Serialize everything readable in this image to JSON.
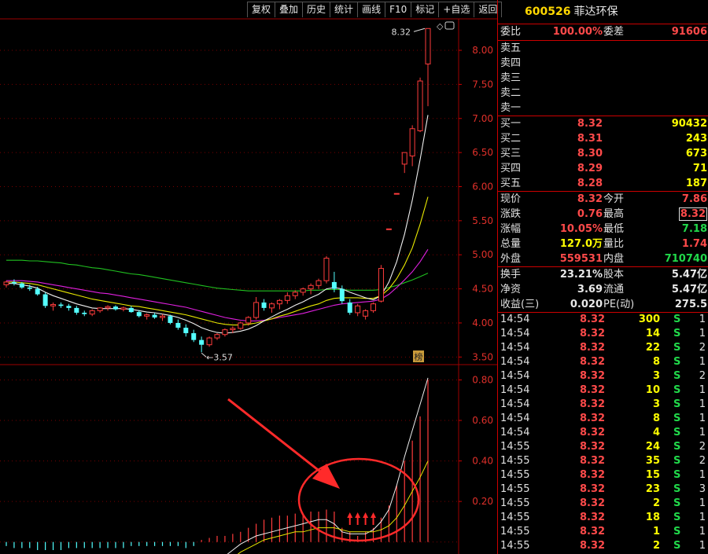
{
  "toolbar": [
    "复权",
    "叠加",
    "历史",
    "统计",
    "画线",
    "F10",
    "标记",
    "+自选",
    "返回"
  ],
  "stock": {
    "code": "600526",
    "name": "菲达环保"
  },
  "weibi": {
    "label": "委比",
    "value": "100.00%",
    "label2": "委差",
    "value2": "91606"
  },
  "sells": [
    {
      "label": "卖五"
    },
    {
      "label": "卖四"
    },
    {
      "label": "卖三"
    },
    {
      "label": "卖二"
    },
    {
      "label": "卖一"
    }
  ],
  "buys": [
    {
      "label": "买一",
      "price": "8.32",
      "volume": "90432"
    },
    {
      "label": "买二",
      "price": "8.31",
      "volume": "243"
    },
    {
      "label": "买三",
      "price": "8.30",
      "volume": "673"
    },
    {
      "label": "买四",
      "price": "8.29",
      "volume": "71"
    },
    {
      "label": "买五",
      "price": "8.28",
      "volume": "187"
    }
  ],
  "quote": [
    {
      "l1": "现价",
      "v1": "8.32",
      "c1": "red",
      "l2": "今开",
      "v2": "7.86",
      "c2": "red"
    },
    {
      "l1": "涨跌",
      "v1": "0.76",
      "c1": "red",
      "l2": "最高",
      "v2": "8.32",
      "c2": "red",
      "boxed": true
    },
    {
      "l1": "涨幅",
      "v1": "10.05%",
      "c1": "red",
      "l2": "最低",
      "v2": "7.18",
      "c2": "grn"
    },
    {
      "l1": "总量",
      "v1": "127.0万",
      "c1": "yel",
      "l2": "量比",
      "v2": "1.74",
      "c2": "red"
    },
    {
      "l1": "外盘",
      "v1": "559531",
      "c1": "red",
      "l2": "内盘",
      "v2": "710740",
      "c2": "grn"
    }
  ],
  "fundamentals": [
    {
      "l1": "换手",
      "v1": "23.21%",
      "l2": "股本",
      "v2": "5.47亿"
    },
    {
      "l1": "净资",
      "v1": "3.69",
      "l2": "流通",
      "v2": "5.47亿"
    },
    {
      "l1": "收益(三)",
      "v1": "0.020",
      "l2": "PE(动)",
      "v2": "275.5"
    }
  ],
  "ticks": [
    {
      "time": "14:54",
      "price": "8.32",
      "vol": "300",
      "side": "S",
      "n": "1"
    },
    {
      "time": "14:54",
      "price": "8.32",
      "vol": "14",
      "side": "S",
      "n": "1"
    },
    {
      "time": "14:54",
      "price": "8.32",
      "vol": "22",
      "side": "S",
      "n": "2"
    },
    {
      "time": "14:54",
      "price": "8.32",
      "vol": "8",
      "side": "S",
      "n": "1"
    },
    {
      "time": "14:54",
      "price": "8.32",
      "vol": "3",
      "side": "S",
      "n": "2"
    },
    {
      "time": "14:54",
      "price": "8.32",
      "vol": "10",
      "side": "S",
      "n": "1"
    },
    {
      "time": "14:54",
      "price": "8.32",
      "vol": "3",
      "side": "S",
      "n": "1"
    },
    {
      "time": "14:54",
      "price": "8.32",
      "vol": "8",
      "side": "S",
      "n": "1"
    },
    {
      "time": "14:54",
      "price": "8.32",
      "vol": "4",
      "side": "S",
      "n": "1"
    },
    {
      "time": "14:55",
      "price": "8.32",
      "vol": "24",
      "side": "S",
      "n": "2"
    },
    {
      "time": "14:55",
      "price": "8.32",
      "vol": "35",
      "side": "S",
      "n": "2"
    },
    {
      "time": "14:55",
      "price": "8.32",
      "vol": "15",
      "side": "S",
      "n": "1"
    },
    {
      "time": "14:55",
      "price": "8.32",
      "vol": "23",
      "side": "S",
      "n": "3"
    },
    {
      "time": "14:55",
      "price": "8.32",
      "vol": "2",
      "side": "S",
      "n": "1"
    },
    {
      "time": "14:55",
      "price": "8.32",
      "vol": "18",
      "side": "S",
      "n": "1"
    },
    {
      "time": "14:55",
      "price": "8.32",
      "vol": "1",
      "side": "S",
      "n": "1"
    },
    {
      "time": "14:55",
      "price": "8.32",
      "vol": "2",
      "side": "S",
      "n": "1"
    }
  ],
  "chart_data": {
    "type": "candlestick",
    "price_axis": {
      "ticks": [
        "8.00",
        "7.50",
        "7.00",
        "6.50",
        "6.00",
        "5.50",
        "5.00",
        "4.50",
        "4.00",
        "3.50"
      ],
      "range": [
        3.4,
        8.45
      ]
    },
    "indicator_axis": {
      "ticks": [
        "0.80",
        "0.60",
        "0.40",
        "0.20"
      ],
      "range": [
        -0.04,
        0.86
      ]
    },
    "high_label": "8.32",
    "low_label": "3.57",
    "badge": "榜",
    "candles": [
      [
        4.56,
        4.62,
        4.52,
        4.6
      ],
      [
        4.6,
        4.64,
        4.55,
        4.58
      ],
      [
        4.58,
        4.6,
        4.5,
        4.52
      ],
      [
        4.52,
        4.56,
        4.47,
        4.5
      ],
      [
        4.5,
        4.53,
        4.4,
        4.42
      ],
      [
        4.42,
        4.45,
        4.22,
        4.25
      ],
      [
        4.25,
        4.3,
        4.18,
        4.27
      ],
      [
        4.27,
        4.3,
        4.22,
        4.25
      ],
      [
        4.25,
        4.28,
        4.18,
        4.22
      ],
      [
        4.22,
        4.25,
        4.12,
        4.15
      ],
      [
        4.15,
        4.18,
        4.1,
        4.13
      ],
      [
        4.13,
        4.2,
        4.1,
        4.18
      ],
      [
        4.18,
        4.23,
        4.15,
        4.22
      ],
      [
        4.22,
        4.26,
        4.18,
        4.24
      ],
      [
        4.24,
        4.26,
        4.18,
        4.2
      ],
      [
        4.2,
        4.24,
        4.17,
        4.22
      ],
      [
        4.22,
        4.25,
        4.15,
        4.16
      ],
      [
        4.16,
        4.19,
        4.08,
        4.1
      ],
      [
        4.1,
        4.14,
        4.05,
        4.12
      ],
      [
        4.12,
        4.15,
        4.06,
        4.08
      ],
      [
        4.08,
        4.13,
        4.03,
        4.1
      ],
      [
        4.1,
        4.12,
        3.98,
        4.0
      ],
      [
        4.0,
        4.05,
        3.9,
        3.93
      ],
      [
        3.93,
        3.98,
        3.8,
        3.85
      ],
      [
        3.85,
        3.9,
        3.72,
        3.75
      ],
      [
        3.75,
        3.8,
        3.57,
        3.68
      ],
      [
        3.68,
        3.8,
        3.65,
        3.78
      ],
      [
        3.78,
        3.85,
        3.75,
        3.83
      ],
      [
        3.83,
        3.92,
        3.8,
        3.9
      ],
      [
        3.9,
        3.95,
        3.85,
        3.92
      ],
      [
        3.92,
        4.02,
        3.9,
        4.0
      ],
      [
        4.0,
        4.1,
        3.96,
        4.08
      ],
      [
        4.08,
        4.38,
        4.05,
        4.3
      ],
      [
        4.3,
        4.35,
        4.18,
        4.22
      ],
      [
        4.22,
        4.3,
        4.15,
        4.28
      ],
      [
        4.28,
        4.35,
        4.2,
        4.33
      ],
      [
        4.33,
        4.45,
        4.28,
        4.4
      ],
      [
        4.4,
        4.48,
        4.35,
        4.45
      ],
      [
        4.45,
        4.52,
        4.4,
        4.5
      ],
      [
        4.5,
        4.58,
        4.42,
        4.55
      ],
      [
        4.55,
        4.65,
        4.5,
        4.62
      ],
      [
        4.62,
        4.98,
        4.58,
        4.95
      ],
      [
        4.6,
        4.75,
        4.45,
        4.5
      ],
      [
        4.5,
        4.55,
        4.28,
        4.32
      ],
      [
        4.3,
        4.35,
        4.12,
        4.15
      ],
      [
        4.15,
        4.28,
        4.1,
        4.25
      ],
      [
        4.1,
        4.2,
        4.05,
        4.18
      ],
      [
        4.18,
        4.3,
        4.15,
        4.28
      ],
      [
        4.32,
        4.85,
        4.3,
        4.8
      ],
      [
        5.38,
        5.38,
        5.38,
        5.38
      ],
      [
        5.9,
        5.9,
        5.9,
        5.9
      ],
      [
        6.33,
        6.5,
        6.2,
        6.5
      ],
      [
        6.45,
        6.9,
        6.3,
        6.85
      ],
      [
        6.82,
        7.6,
        6.8,
        7.55
      ],
      [
        7.8,
        8.32,
        7.18,
        8.32
      ]
    ],
    "ma_lines": {
      "white": [
        4.58,
        4.58,
        4.56,
        4.54,
        4.51,
        4.45,
        4.4,
        4.36,
        4.32,
        4.28,
        4.25,
        4.22,
        4.21,
        4.21,
        4.21,
        4.21,
        4.2,
        4.18,
        4.16,
        4.15,
        4.13,
        4.11,
        4.08,
        4.04,
        3.99,
        3.93,
        3.89,
        3.86,
        3.85,
        3.86,
        3.88,
        3.91,
        3.96,
        4.03,
        4.09,
        4.15,
        4.2,
        4.26,
        4.31,
        4.37,
        4.42,
        4.5,
        4.52,
        4.5,
        4.45,
        4.41,
        4.37,
        4.34,
        4.4,
        4.6,
        4.9,
        5.3,
        5.8,
        6.4,
        7.05
      ],
      "yellow": [
        4.6,
        4.6,
        4.59,
        4.58,
        4.56,
        4.53,
        4.5,
        4.47,
        4.44,
        4.41,
        4.38,
        4.35,
        4.33,
        4.31,
        4.29,
        4.27,
        4.25,
        4.24,
        4.22,
        4.2,
        4.18,
        4.16,
        4.14,
        4.12,
        4.09,
        4.06,
        4.03,
        4.0,
        3.98,
        3.97,
        3.97,
        3.98,
        4.0,
        4.03,
        4.06,
        4.1,
        4.13,
        4.17,
        4.21,
        4.25,
        4.28,
        4.33,
        4.36,
        4.37,
        4.37,
        4.37,
        4.36,
        4.36,
        4.4,
        4.5,
        4.65,
        4.85,
        5.1,
        5.45,
        5.85
      ],
      "magenta": [
        4.62,
        4.62,
        4.62,
        4.61,
        4.6,
        4.58,
        4.56,
        4.54,
        4.52,
        4.5,
        4.48,
        4.46,
        4.44,
        4.43,
        4.41,
        4.39,
        4.37,
        4.35,
        4.33,
        4.31,
        4.29,
        4.27,
        4.25,
        4.23,
        4.2,
        4.17,
        4.14,
        4.11,
        4.08,
        4.06,
        4.04,
        4.03,
        4.03,
        4.04,
        4.06,
        4.08,
        4.1,
        4.12,
        4.14,
        4.17,
        4.2,
        4.23,
        4.26,
        4.28,
        4.29,
        4.3,
        4.31,
        4.32,
        4.35,
        4.42,
        4.52,
        4.63,
        4.75,
        4.9,
        5.08
      ],
      "green": [
        4.92,
        4.92,
        4.92,
        4.91,
        4.91,
        4.9,
        4.89,
        4.88,
        4.86,
        4.85,
        4.83,
        4.81,
        4.8,
        4.78,
        4.76,
        4.74,
        4.72,
        4.71,
        4.69,
        4.67,
        4.65,
        4.63,
        4.61,
        4.59,
        4.57,
        4.55,
        4.53,
        4.51,
        4.5,
        4.49,
        4.48,
        4.47,
        4.47,
        4.47,
        4.47,
        4.47,
        4.47,
        4.47,
        4.47,
        4.48,
        4.48,
        4.49,
        4.49,
        4.49,
        4.48,
        4.48,
        4.48,
        4.48,
        4.49,
        4.52,
        4.55,
        4.59,
        4.63,
        4.68,
        4.73
      ]
    },
    "indicator_bars": [
      -0.02,
      -0.03,
      -0.03,
      -0.03,
      -0.04,
      -0.04,
      -0.04,
      -0.04,
      -0.03,
      -0.03,
      -0.03,
      -0.03,
      -0.03,
      -0.03,
      -0.03,
      -0.03,
      -0.02,
      -0.02,
      -0.02,
      -0.02,
      -0.02,
      -0.02,
      -0.02,
      -0.03,
      -0.02,
      0.01,
      0.02,
      0.03,
      0.03,
      0.04,
      0.05,
      0.07,
      0.09,
      0.11,
      0.12,
      0.13,
      0.13,
      0.14,
      0.14,
      0.15,
      0.15,
      0.16,
      0.15,
      0.07,
      0.05,
      0.03,
      0.05,
      0.07,
      0.12,
      0.18,
      0.28,
      0.4,
      0.5,
      0.62,
      0.8
    ],
    "indicator_white": [
      -0.16,
      -0.16,
      -0.16,
      -0.16,
      -0.16,
      -0.16,
      -0.16,
      -0.16,
      -0.16,
      -0.16,
      -0.16,
      -0.16,
      -0.16,
      -0.16,
      -0.16,
      -0.16,
      -0.16,
      -0.16,
      -0.16,
      -0.16,
      -0.16,
      -0.16,
      -0.16,
      -0.16,
      -0.16,
      -0.14,
      -0.12,
      -0.1,
      -0.07,
      -0.04,
      -0.01,
      0.01,
      0.03,
      0.04,
      0.05,
      0.06,
      0.07,
      0.08,
      0.09,
      0.1,
      0.11,
      0.11,
      0.09,
      0.05,
      0.04,
      0.04,
      0.04,
      0.06,
      0.1,
      0.16,
      0.28,
      0.42,
      0.55,
      0.68,
      0.81
    ],
    "indicator_yellow": [
      -0.17,
      -0.17,
      -0.17,
      -0.17,
      -0.17,
      -0.17,
      -0.17,
      -0.17,
      -0.17,
      -0.17,
      -0.17,
      -0.17,
      -0.17,
      -0.17,
      -0.17,
      -0.17,
      -0.17,
      -0.17,
      -0.17,
      -0.17,
      -0.17,
      -0.17,
      -0.17,
      -0.17,
      -0.17,
      -0.16,
      -0.15,
      -0.13,
      -0.1,
      -0.08,
      -0.05,
      -0.03,
      -0.01,
      0.01,
      0.02,
      0.03,
      0.04,
      0.05,
      0.05,
      0.06,
      0.07,
      0.07,
      0.07,
      0.06,
      0.05,
      0.05,
      0.05,
      0.05,
      0.06,
      0.08,
      0.12,
      0.18,
      0.25,
      0.32,
      0.4
    ],
    "up_arrows_at": [
      44,
      45,
      46,
      47
    ]
  }
}
